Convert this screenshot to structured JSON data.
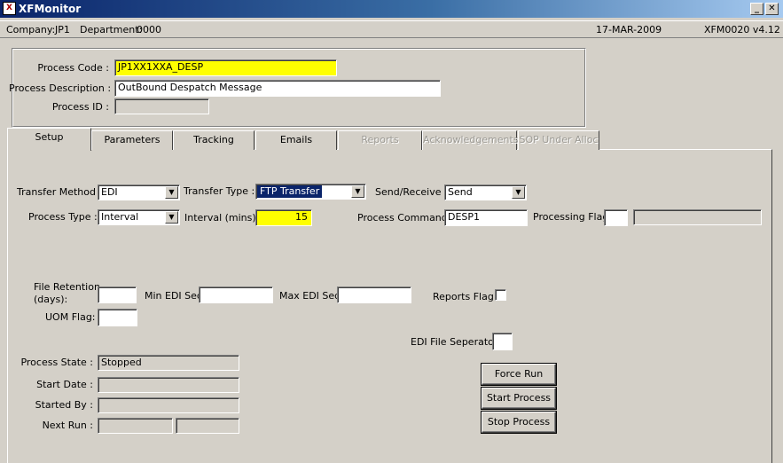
{
  "window": {
    "title": "XFMonitor",
    "icon": "app-icon",
    "minimize_glyph": "_",
    "close_glyph": "✕"
  },
  "infobar": {
    "company_label": "Company:",
    "company": "JP1",
    "department_label": "Department:",
    "department": "0000",
    "date": "17-MAR-2009",
    "version": "XFM0020  v4.12"
  },
  "header": {
    "process_code_label": "Process Code :",
    "process_code": "JP1XX1XXA_DESP",
    "process_description_label": "Process Description :",
    "process_description": "OutBound Despatch Message",
    "process_id_label": "Process ID :",
    "process_id": ""
  },
  "tabs": [
    {
      "label": "Setup",
      "active": true,
      "enabled": true
    },
    {
      "label": "Parameters",
      "enabled": true
    },
    {
      "label": "Tracking",
      "enabled": true
    },
    {
      "label": "Emails",
      "enabled": true
    },
    {
      "label": "Reports",
      "enabled": false
    },
    {
      "label": "Acknowledgements",
      "enabled": false
    },
    {
      "label": "SOP Under Alloc",
      "enabled": false
    }
  ],
  "setup": {
    "transfer_method_label": "Transfer Method :",
    "transfer_method": "EDI",
    "transfer_type_label": "Transfer Type :",
    "transfer_type": "FTP Transfer",
    "send_receive_label": "Send/Receive :",
    "send_receive": "Send",
    "process_type_label": "Process Type :",
    "process_type": "Interval",
    "interval_label": "Interval (mins) :",
    "interval": "15",
    "process_command_label": "Process Command:",
    "process_command": "DESP1",
    "processing_flag_label": "Processing Flag",
    "processing_flag": "",
    "file_retention_label_1": "File Retention",
    "file_retention_label_2": "(days):",
    "file_retention": "",
    "min_edi_seq_label": "Min EDI Seq:",
    "min_edi_seq": "",
    "max_edi_seq_label": "Max EDI Seq:",
    "max_edi_seq": "",
    "reports_flag_label": "Reports Flag:",
    "uom_flag_label": "UOM Flag:",
    "uom_flag": "",
    "edi_file_separator_label": "EDI File Seperator:",
    "edi_file_separator": "",
    "process_state_label": "Process State :",
    "process_state": "Stopped",
    "start_date_label": "Start Date :",
    "start_date": "",
    "started_by_label": "Started By :",
    "started_by": "",
    "next_run_label": "Next Run :",
    "next_run_date": "",
    "next_run_time": "",
    "force_run_label": "Force Run",
    "start_process_label": "Start Process",
    "stop_process_label": "Stop Process"
  },
  "colors": {
    "highlight_field": "#ffff00",
    "selection": "#0a246a",
    "titlebar": "#0a246a"
  }
}
